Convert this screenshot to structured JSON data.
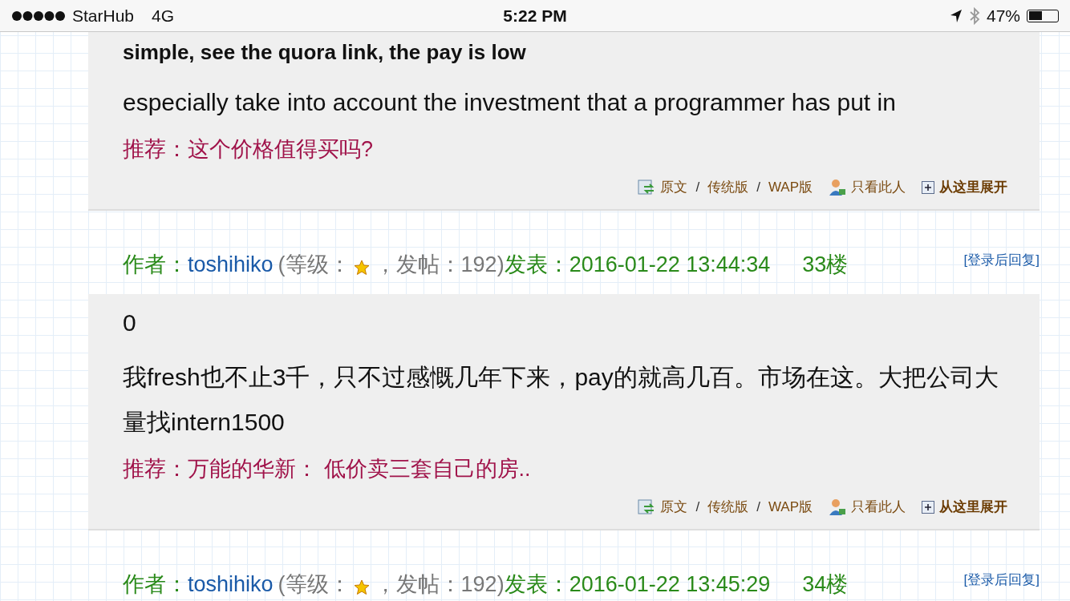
{
  "status_bar": {
    "carrier": "StarHub",
    "network": "4G",
    "time": "5:22 PM",
    "battery": "47%"
  },
  "entries": [
    {
      "kind": "post",
      "paragraphs": [
        "simple, see the quora link, the pay is low",
        "especially take into account the investment that a programmer has put in"
      ],
      "recommend": "推荐：这个价格值得买吗?",
      "actions": {
        "original": "原文",
        "sep1": "/",
        "classic": "传统版",
        "sep2": "/",
        "wap": "WAP版",
        "only_author": "只看此人",
        "expand": "从这里展开"
      }
    },
    {
      "kind": "author",
      "label": "作者：",
      "name": "toshihiko",
      "meta_open": "(等级：",
      "meta_rest": "，发帖：192)",
      "posted": "发表：2016-01-22 13:44:34",
      "floor": "33楼",
      "reply": "[登录后回复]"
    },
    {
      "kind": "post",
      "paragraphs": [
        "0",
        "我fresh也不止3千，只不过感慨几年下来，pay的就高几百。市场在这。大把公司大量找intern1500"
      ],
      "recommend": "推荐：万能的华新：  低价卖三套自己的房..",
      "actions": {
        "original": "原文",
        "sep1": "/",
        "classic": "传统版",
        "sep2": "/",
        "wap": "WAP版",
        "only_author": "只看此人",
        "expand": "从这里展开"
      }
    },
    {
      "kind": "author",
      "label": "作者：",
      "name": "toshihiko",
      "meta_open": "(等级：",
      "meta_rest": "，发帖：192)",
      "posted": "发表：2016-01-22 13:45:29",
      "floor": "34楼",
      "reply": "[登录后回复]"
    }
  ]
}
